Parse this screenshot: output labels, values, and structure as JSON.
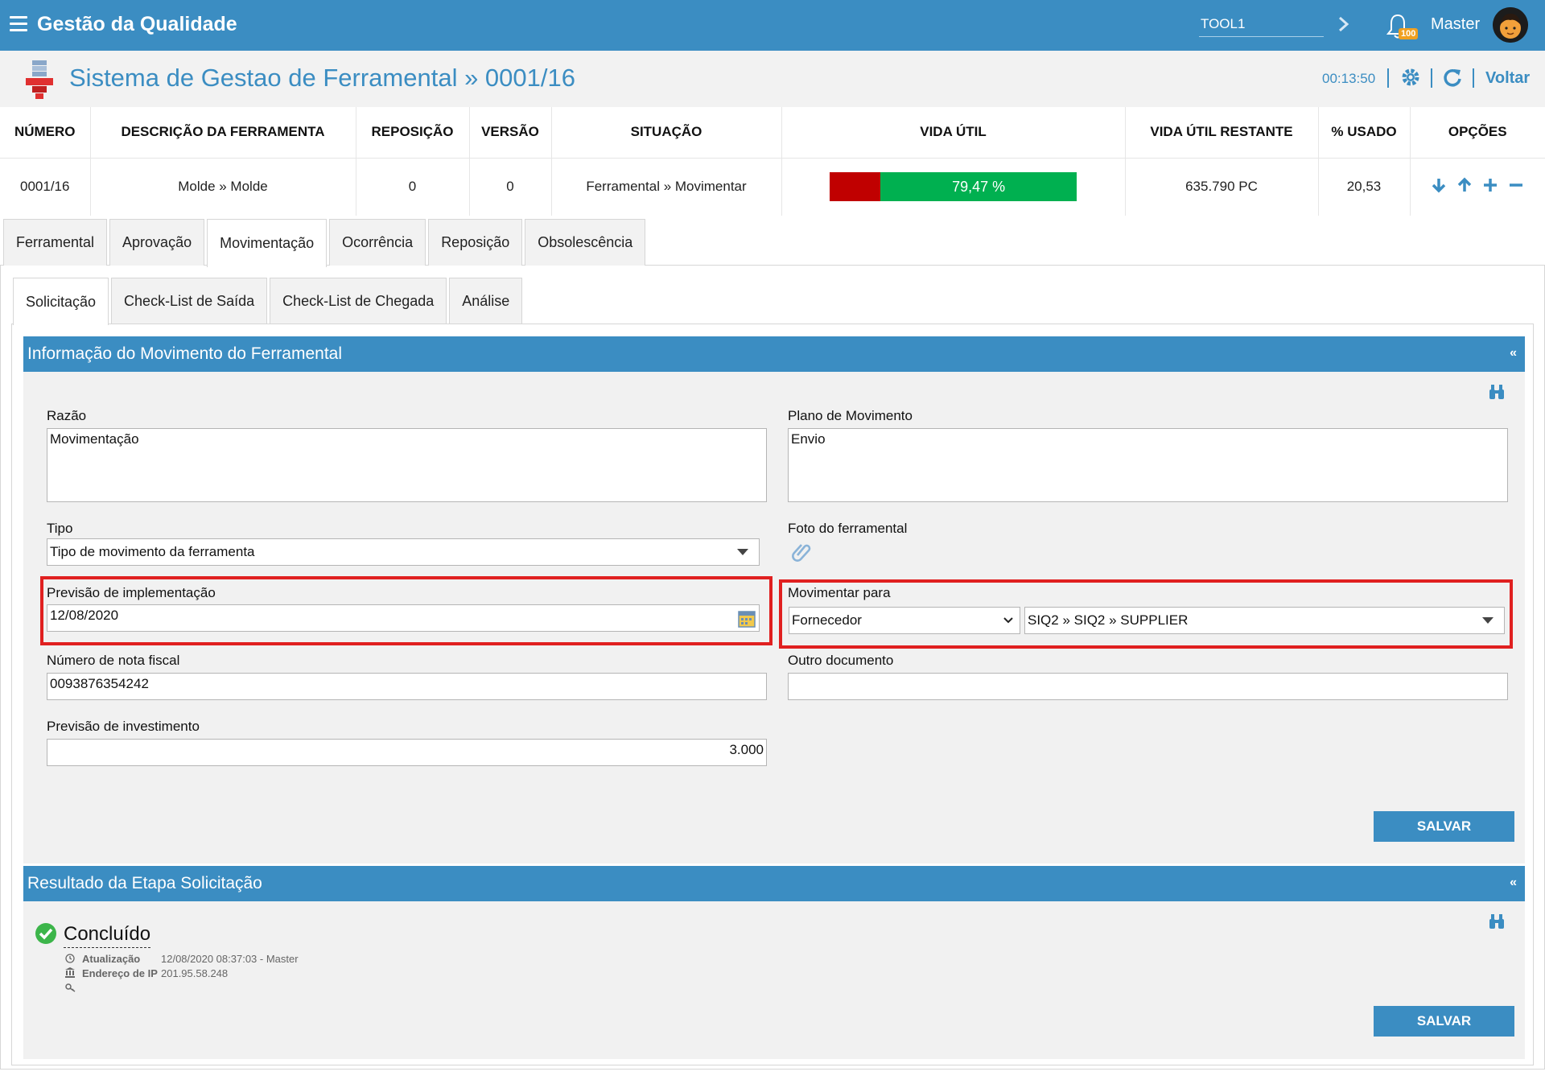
{
  "app": {
    "title": "Gestão da Qualidade",
    "search_value": "TOOL1",
    "notifications": "100",
    "user": "Master"
  },
  "header": {
    "title": "Sistema de Gestao de Ferramental » 0001/16",
    "timer": "00:13:50",
    "back": "Voltar"
  },
  "summary": {
    "columns": [
      "NÚMERO",
      "DESCRIÇÃO DA FERRAMENTA",
      "REPOSIÇÃO",
      "VERSÃO",
      "SITUAÇÃO",
      "VIDA ÚTIL",
      "VIDA ÚTIL RESTANTE",
      "% USADO",
      "OPÇÕES"
    ],
    "row": {
      "numero": "0001/16",
      "descricao": "Molde » Molde",
      "reposicao": "0",
      "versao": "0",
      "situacao": "Ferramental » Movimentar",
      "vida_util_label": "79,47 %",
      "vida_util_pct": 79.47,
      "restante": "635.790 PC",
      "usado": "20,53"
    },
    "colors": {
      "used": "#c00000",
      "remaining": "#00b050"
    }
  },
  "tabs_main": [
    "Ferramental",
    "Aprovação",
    "Movimentação",
    "Ocorrência",
    "Reposição",
    "Obsolescência"
  ],
  "tabs_main_active": "Movimentação",
  "tabs_sub": [
    "Solicitação",
    "Check-List de Saída",
    "Check-List de Chegada",
    "Análise"
  ],
  "tabs_sub_active": "Solicitação",
  "form": {
    "section_title": "Informação do Movimento do Ferramental",
    "razao_label": "Razão",
    "razao_value": "Movimentação",
    "plano_label": "Plano de Movimento",
    "plano_value": "Envio",
    "tipo_label": "Tipo",
    "tipo_value": "Tipo de movimento da ferramenta",
    "foto_label": "Foto do ferramental",
    "previsao_label": "Previsão de implementação",
    "previsao_value": "12/08/2020",
    "movimentar_label": "Movimentar para",
    "movimentar_tipo": "Fornecedor",
    "movimentar_destino": "SIQ2 » SIQ2 » SUPPLIER",
    "nota_label": "Número de nota fiscal",
    "nota_value": "0093876354242",
    "outro_label": "Outro documento",
    "outro_value": "",
    "invest_label": "Previsão de investimento",
    "invest_value": "3.000",
    "save": "SALVAR"
  },
  "result": {
    "section_title": "Resultado da Etapa Solicitação",
    "status": "Concluído",
    "update_label": "Atualização",
    "update_value": "12/08/2020 08:37:03 - Master",
    "ip_label": "Endereço de IP",
    "ip_value": "201.95.58.248",
    "save": "SALVAR"
  }
}
